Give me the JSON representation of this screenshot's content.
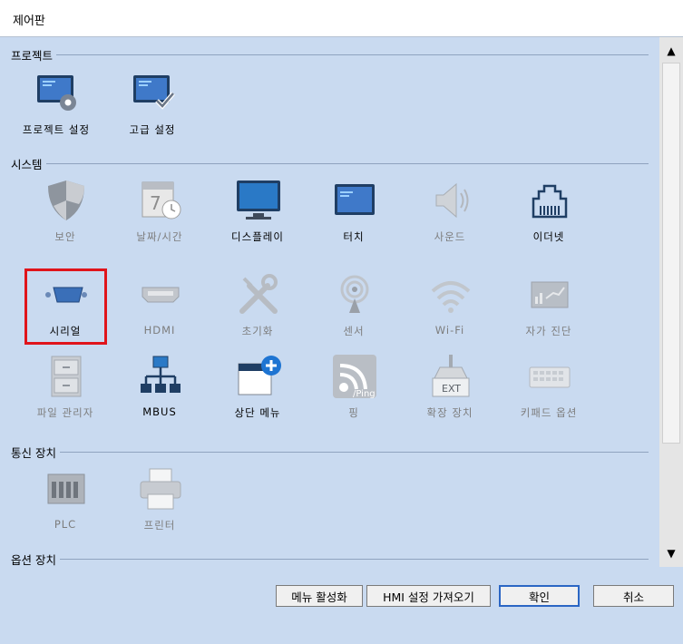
{
  "window": {
    "title": "제어판"
  },
  "sections": {
    "project": "프로젝트",
    "system": "시스템",
    "comm": "통신 장치",
    "options": "옵션 장치"
  },
  "items": {
    "project_settings": "프로젝트 설정",
    "advanced_settings": "고급 설정",
    "security": "보안",
    "datetime": "날짜/시간",
    "display": "디스플레이",
    "touch": "터치",
    "sound": "사운드",
    "ethernet": "이더넷",
    "serial": "시리얼",
    "hdmi": "HDMI",
    "reset": "초기화",
    "sensor": "센서",
    "wifi": "Wi-Fi",
    "selftest": "자가 진단",
    "file_manager": "파일 관리자",
    "mbus": "MBUS",
    "top_menu": "상단 메뉴",
    "ping": "핑",
    "expansion": "확장 장치",
    "keypad": "키패드 옵션",
    "plc": "PLC",
    "printer": "프린터"
  },
  "icon_text": {
    "ping": "/Ping",
    "ext": "EXT",
    "calendar_day": "7"
  },
  "buttons": {
    "menu_activate": "메뉴 활성화",
    "hmi_import": "HMI 설정 가져오기",
    "ok": "확인",
    "cancel": "취소"
  },
  "colors": {
    "background": "#c9daf0",
    "selection": "#e0141b",
    "primary_border": "#2b66c4"
  }
}
